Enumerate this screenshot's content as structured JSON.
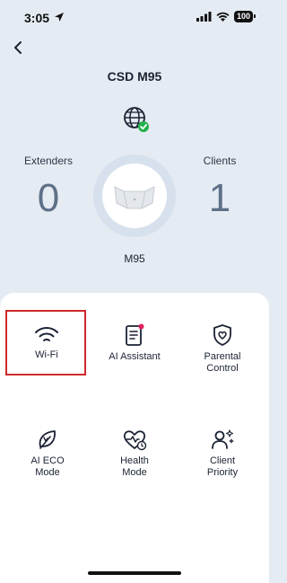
{
  "status_bar": {
    "time": "3:05",
    "battery": "100"
  },
  "header": {
    "device_title": "CSD M95"
  },
  "stats": {
    "extenders_label": "Extenders",
    "extenders_count": "0",
    "clients_label": "Clients",
    "clients_count": "1",
    "device_name": "M95"
  },
  "features": [
    {
      "label": "Wi-Fi",
      "icon": "wifi-icon"
    },
    {
      "label": "AI Assistant",
      "icon": "ai-assistant-icon"
    },
    {
      "label": "Parental\nControl",
      "icon": "parental-control-icon"
    },
    {
      "label": "AI ECO\nMode",
      "icon": "eco-leaf-icon"
    },
    {
      "label": "Health\nMode",
      "icon": "health-heart-icon"
    },
    {
      "label": "Client\nPriority",
      "icon": "client-priority-icon"
    }
  ],
  "colors": {
    "highlight": "#d0282b",
    "status_ok": "#22b14c",
    "accent_red_dot": "#e0245e"
  }
}
